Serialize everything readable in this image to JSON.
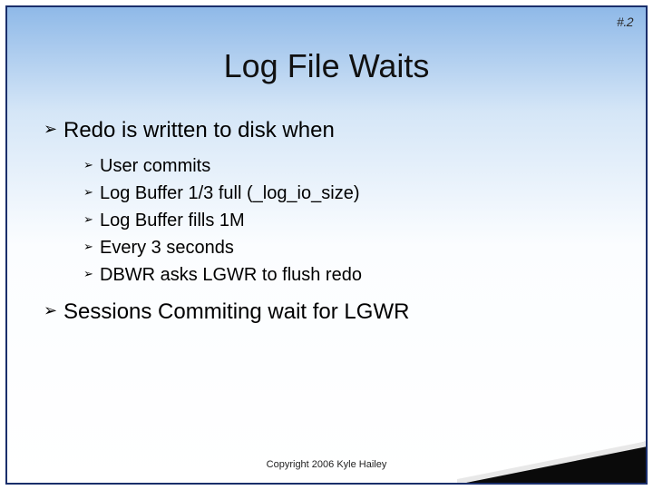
{
  "page_number": "#.2",
  "title": "Log File Waits",
  "bullets": {
    "b1": "Redo is written to disk when",
    "sub": {
      "s1": "User commits",
      "s2": "Log Buffer 1/3 full (_log_io_size)",
      "s3": "Log Buffer fills 1M",
      "s4": "Every 3 seconds",
      "s5": "DBWR asks LGWR to flush redo"
    },
    "b2": "Sessions Commiting wait for LGWR"
  },
  "copyright": "Copyright 2006 Kyle Hailey"
}
